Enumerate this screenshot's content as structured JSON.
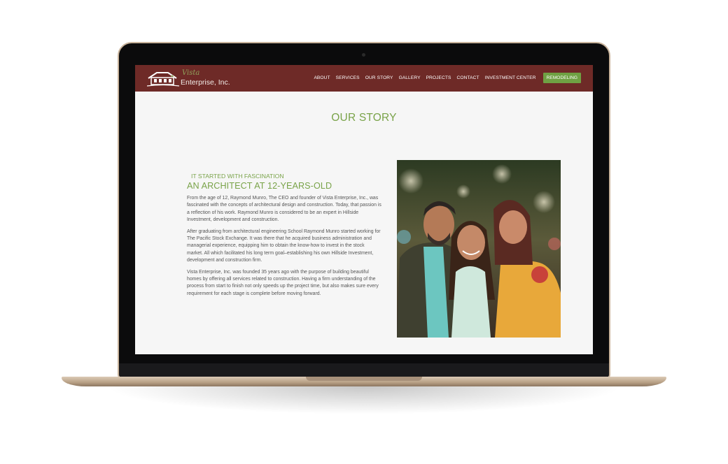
{
  "site": {
    "logo": {
      "script_text": "Vista",
      "name": "Enterprise, Inc."
    },
    "nav": {
      "links": [
        "ABOUT",
        "SERVICES",
        "OUR STORY",
        "GALLERY",
        "PROJECTS",
        "CONTACT",
        "INVESTMENT CENTER"
      ],
      "cta": "REMODELING"
    },
    "page_title": "OUR STORY",
    "story": {
      "kicker": "IT STARTED WITH FASCINATION",
      "headline": "AN ARCHITECT AT 12-YEARS-OLD",
      "paragraphs": [
        "From the age of 12, Raymond Munro, The CEO and founder of Vista Enterprise, Inc., was fascinated with the concepts of architectural design and construction. Today, that passion is a reflection of his work. Raymond Munro is considered to be an expert in Hillside Investment, development and construction.",
        "After graduating from architectural engineering School Raymond Munro started working for The Pacific Stock Exchange. It was there that he acquired business administration and managerial experience, equipping him to obtain the know-how to invest in the stock market. All which facilitated his long term goal–establishing his own Hillside Investment, development and construction firm.",
        "Vista Enterprise, Inc. was founded 35 years ago with the purpose of building beautiful homes by offering all services related to construction. Having a firm understanding of the process from start to finish not only speeds up the project time, but also makes sure every requirement for each stage is complete before moving forward."
      ]
    }
  },
  "colors": {
    "nav_bg": "#6e2a27",
    "accent_green": "#79a349",
    "cta_green": "#6fa143",
    "laptop_gold": "#c9b49c"
  }
}
